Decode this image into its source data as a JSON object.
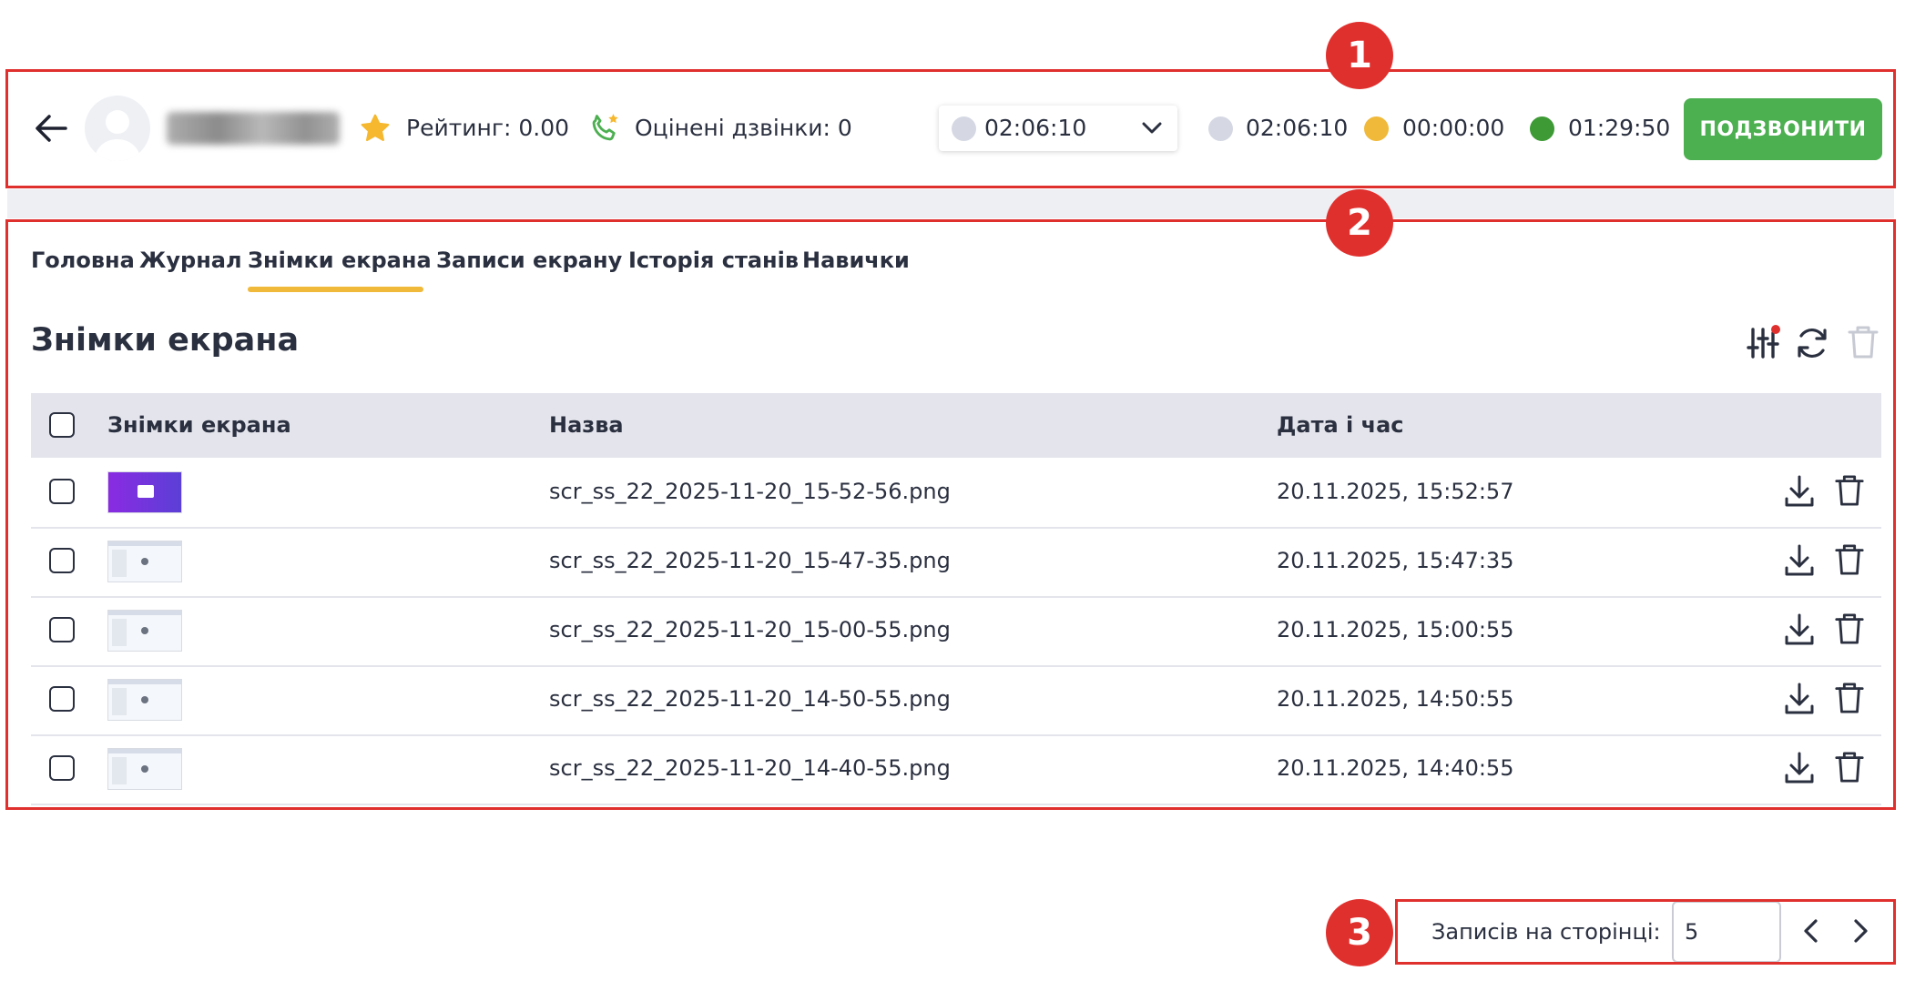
{
  "header": {
    "rating_label": "Рейтинг: 0.00",
    "rated_calls_label": "Оцінені дзвінки: 0",
    "status_select_value": "02:06:10",
    "timers": [
      {
        "value": "02:06:10",
        "color": "#d5d8e3"
      },
      {
        "value": "00:00:00",
        "color": "#f0b93a"
      },
      {
        "value": "01:29:50",
        "color": "#3d9a35"
      }
    ],
    "call_button": "ПОДЗВОНИТИ"
  },
  "annotations": [
    "1",
    "2",
    "3"
  ],
  "tabs": [
    {
      "label": "Головна"
    },
    {
      "label": "Журнал"
    },
    {
      "label": "Знімки екрана",
      "active": true
    },
    {
      "label": "Записи екрану"
    },
    {
      "label": "Історія станів"
    },
    {
      "label": "Навички"
    }
  ],
  "section_title": "Знімки екрана",
  "table": {
    "headers": [
      "Знімки екрана",
      "Назва",
      "Дата і час"
    ],
    "rows": [
      {
        "thumb": "purple",
        "name": "scr_ss_22_2025-11-20_15-52-56.png",
        "datetime": "20.11.2025, 15:52:57"
      },
      {
        "thumb": "light",
        "name": "scr_ss_22_2025-11-20_15-47-35.png",
        "datetime": "20.11.2025, 15:47:35"
      },
      {
        "thumb": "light",
        "name": "scr_ss_22_2025-11-20_15-00-55.png",
        "datetime": "20.11.2025, 15:00:55"
      },
      {
        "thumb": "light",
        "name": "scr_ss_22_2025-11-20_14-50-55.png",
        "datetime": "20.11.2025, 14:50:55"
      },
      {
        "thumb": "light",
        "name": "scr_ss_22_2025-11-20_14-40-55.png",
        "datetime": "20.11.2025, 14:40:55"
      }
    ]
  },
  "pagination": {
    "per_page_label": "Записів на сторінці:",
    "per_page_value": "5"
  },
  "colors": {
    "accent_green": "#4caf50",
    "annotation_red": "#e0302e",
    "tab_underline": "#f0b93a",
    "star": "#f5b82e",
    "phone": "#4caf50"
  },
  "icons": [
    "back-arrow-icon",
    "avatar-icon",
    "star-icon",
    "phone-star-icon",
    "chevron-down-icon",
    "filter-icon",
    "refresh-icon",
    "trash-icon",
    "download-icon",
    "chevron-left-icon",
    "chevron-right-icon"
  ]
}
